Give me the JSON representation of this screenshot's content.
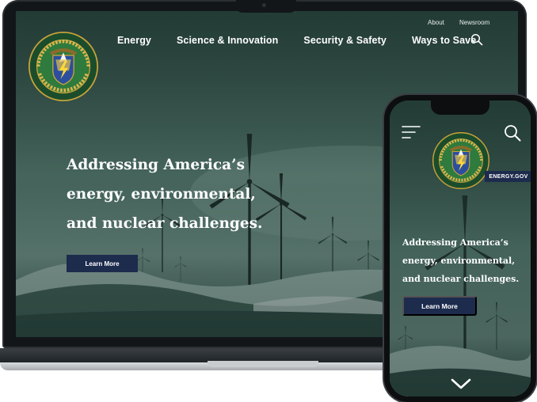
{
  "colors": {
    "brand_navy": "#1d2b4d",
    "scene_teal": "#2d4a40",
    "text": "#ffffff"
  },
  "desktop": {
    "utility_links": [
      "About",
      "Newsroom"
    ],
    "nav": [
      "Energy",
      "Science & Innovation",
      "Security & Safety",
      "Ways to Save"
    ],
    "search_icon": "search-icon",
    "hero_lines": [
      "Addressing America’s",
      "energy, environmental,",
      "and nuclear challenges."
    ],
    "cta_label": "Learn More",
    "logo": "doe-seal-logo"
  },
  "mobile": {
    "menu_icon": "hamburger-menu-icon",
    "search_icon": "search-icon",
    "badge": "ENERGY.GOV",
    "hero_lines": [
      "Addressing America’s",
      "energy, environmental,",
      "and nuclear challenges."
    ],
    "cta_label": "Learn More",
    "scroll_icon": "chevron-down-icon"
  }
}
